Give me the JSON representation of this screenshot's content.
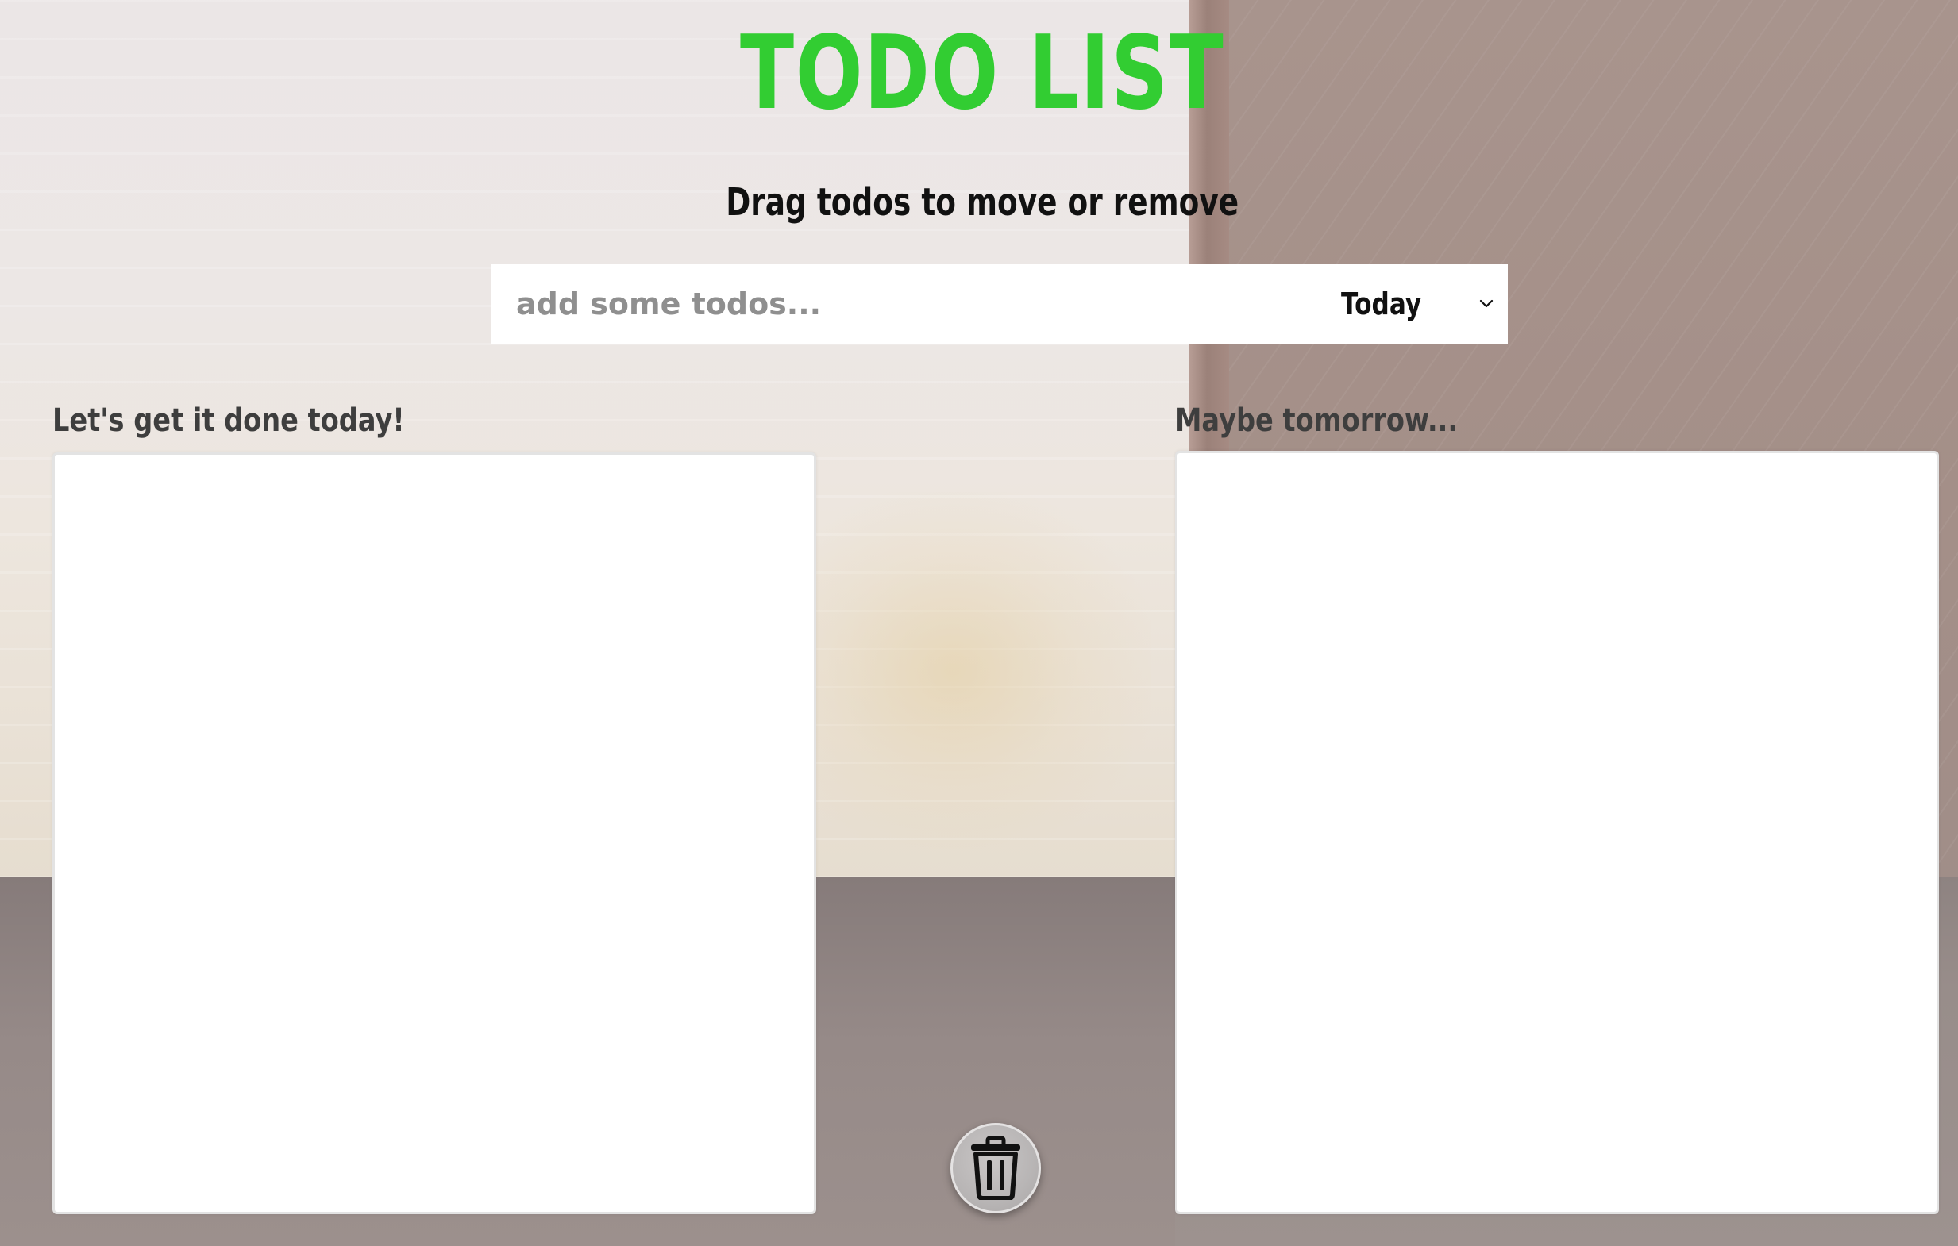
{
  "app": {
    "title": "TODO LIST",
    "subtitle": "Drag todos to move or remove",
    "accent_color": "#32cd32"
  },
  "add_bar": {
    "input_placeholder": "add some todos...",
    "input_value": "",
    "day_select": {
      "selected": "Today",
      "icon": "chevron-down-icon"
    }
  },
  "columns": {
    "today": {
      "heading": "Let's get it done today!",
      "items": []
    },
    "tomorrow": {
      "heading": "Maybe tomorrow...",
      "items": []
    }
  },
  "trash": {
    "icon": "trash-icon"
  }
}
